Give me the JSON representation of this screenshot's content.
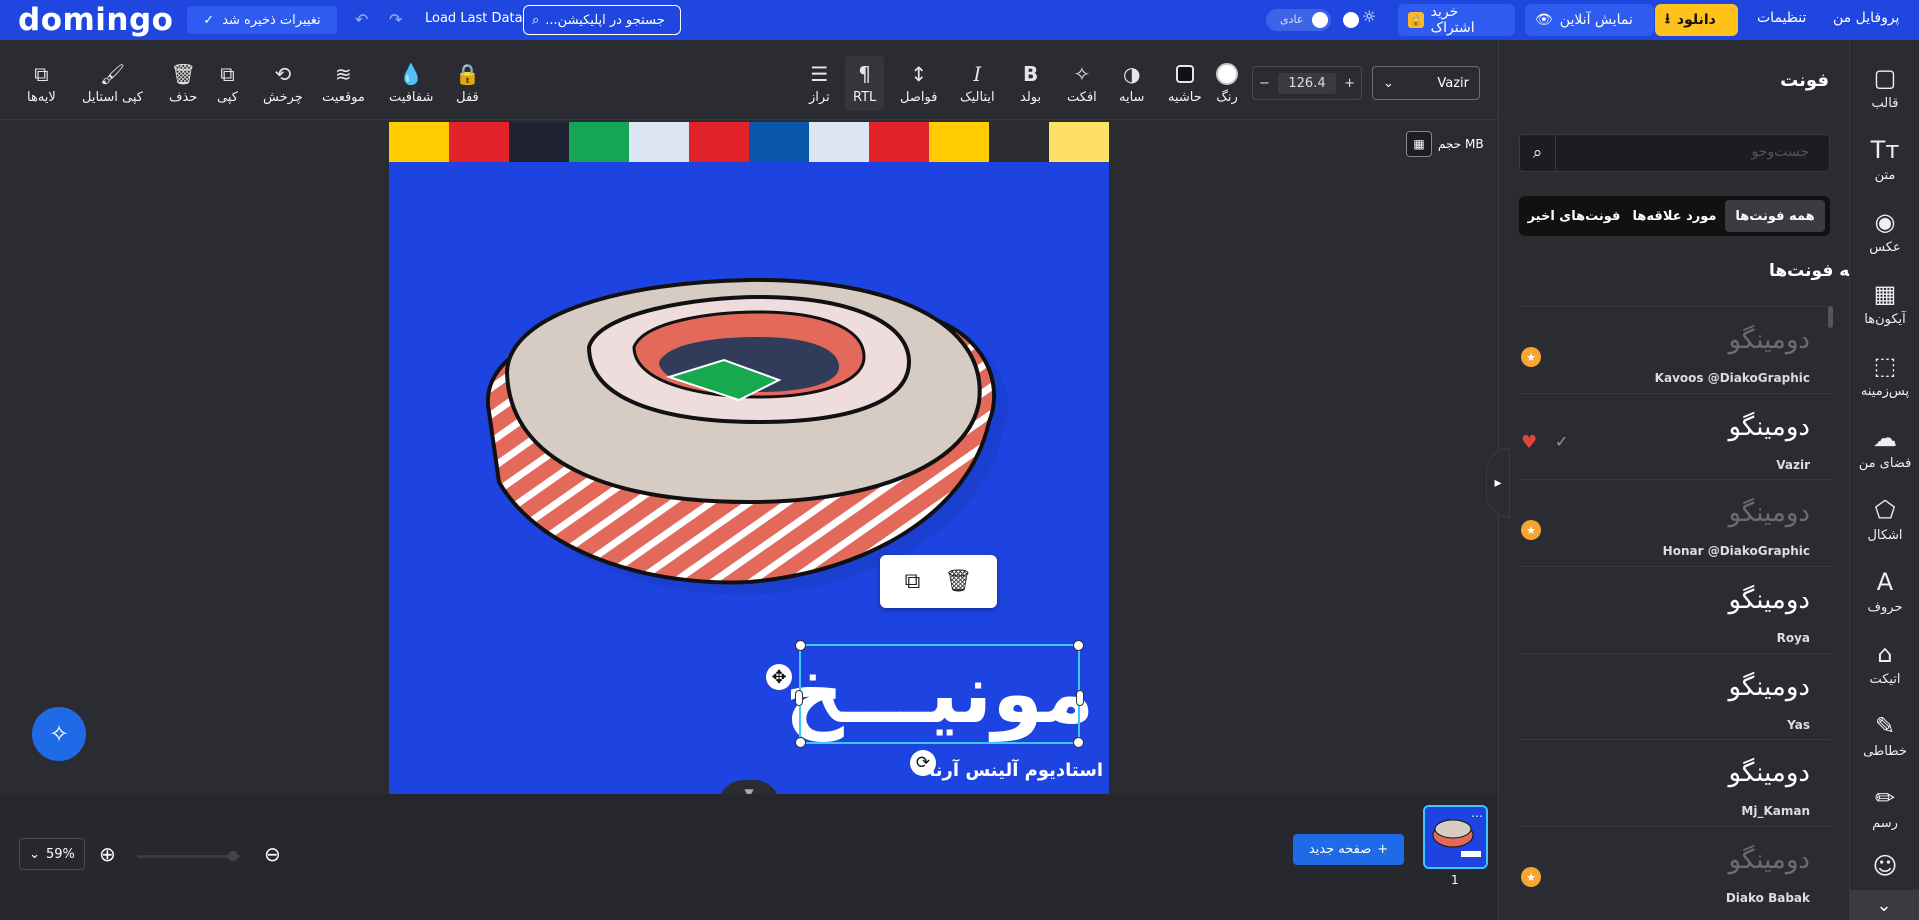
{
  "topbar": {
    "logo": "domingo",
    "save_label": "تغییرات ذخیره شد",
    "load_last": "Load Last Data",
    "search_placeholder": "جستجو در اپلیکیشن...",
    "toggle_label": "عادی",
    "buy_subscription": "خرید اشتراک",
    "online_view": "نمایش آنلاین",
    "download": "دانلود",
    "settings": "تنظیمات",
    "profile": "پروفایل من"
  },
  "toolbar": {
    "layers": "لایه‌ها",
    "copy_style": "کپی استایل",
    "delete": "حذف",
    "copy": "کپی",
    "rotate": "چرخش",
    "position": "موقعیت",
    "opacity": "شفافیت",
    "lock": "قفل",
    "align": "تراز",
    "rtl": "RTL",
    "spacing": "فواصل",
    "italic": "ایتالیک",
    "bold": "بولد",
    "effect": "افکت",
    "shadow": "سایه",
    "border": "حاشیه",
    "color": "رنگ",
    "font_size": "126.4",
    "font_name": "Vazir"
  },
  "canvas": {
    "size_label": "حجم MB",
    "headline": "مونیـــخ",
    "subline": "استادیوم آلینس آرنا",
    "stripe_colors": [
      "#ffcc00",
      "#e3232a",
      "#1f2230",
      "#16a456",
      "#dce6f2",
      "#e3232a",
      "#0a56ad",
      "#dce6f2",
      "#e3232a",
      "#ffcc00",
      "#2b2c31",
      "#ffe066"
    ]
  },
  "bottom": {
    "zoom": "59%",
    "new_page": "صفحه جدید",
    "page_number": "1"
  },
  "panel": {
    "title": "فونت",
    "search_placeholder": "جست‌وجو",
    "tabs": [
      "همه فونت‌ها",
      "مورد علاقه‌ها",
      "فونت‌های اخیر"
    ],
    "section_title": "همه فونت‌ها",
    "fonts": [
      {
        "sample": "دومینگو",
        "name": "Kavoos @DiakoGraphic",
        "pro": true
      },
      {
        "sample": "دومینگو",
        "name": "Vazir",
        "pro": false
      },
      {
        "sample": "دومینگو",
        "name": "Honar @DiakoGraphic",
        "pro": true
      },
      {
        "sample": "دومینگو",
        "name": "Roya",
        "pro": false
      },
      {
        "sample": "دومینگو",
        "name": "Yas",
        "pro": false
      },
      {
        "sample": "دومینگو",
        "name": "Mj_Kaman",
        "pro": false
      },
      {
        "sample": "دومینگو",
        "name": "Diako Babak",
        "pro": true
      }
    ]
  },
  "sidebar": {
    "items": [
      "قالب",
      "متن",
      "عکس",
      "آیکون‌ها",
      "پس‌زمینه",
      "فضای من",
      "اشکال",
      "حروف",
      "اتیکت",
      "خطاطی",
      "رسم"
    ]
  }
}
